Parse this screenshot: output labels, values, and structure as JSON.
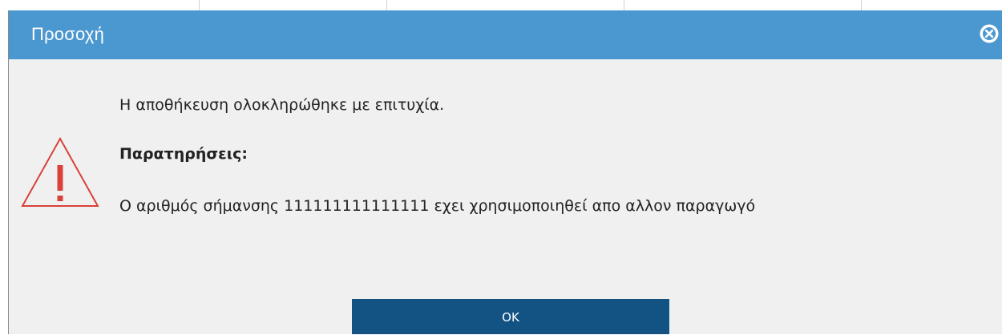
{
  "dialog": {
    "title": "Προσοχή",
    "close_icon": "close-circle-icon",
    "warning_icon": "warning-triangle-icon",
    "message_success": "Η αποθήκευση ολοκληρώθηκε με επιτυχία.",
    "remarks_label": "Παρατηρήσεις:",
    "remark_text": "Ο αριθμός σήμανσης 111111111111111 εχει χρησιμοποιηθεί απο αλλον παραγωγό",
    "ok_label": "OK"
  },
  "colors": {
    "titlebar": "#4b97cf",
    "dialog_background": "#f0f0f0",
    "ok_button": "#135384",
    "warning_icon": "#d9413a"
  }
}
